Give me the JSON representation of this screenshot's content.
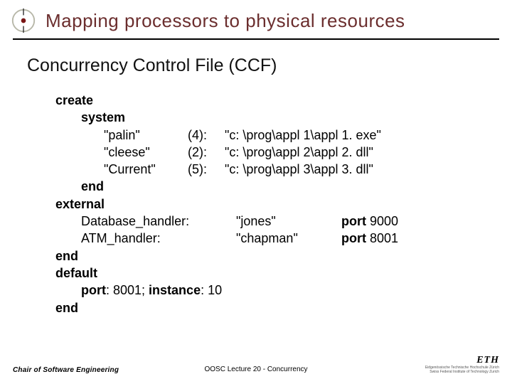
{
  "title": "Mapping processors to physical resources",
  "subtitle": "Concurrency Control File (CCF)",
  "kw": {
    "create": "create",
    "system": "system",
    "end": "end",
    "external": "external",
    "default": "default",
    "port": "port",
    "instance": "instance"
  },
  "system": [
    {
      "name": "\"palin\"",
      "num": "(4):",
      "path": "\"c: \\prog\\appl 1\\appl 1. exe\""
    },
    {
      "name": "\"cleese\"",
      "num": "(2):",
      "path": "\"c: \\prog\\appl 2\\appl 2. dll\""
    },
    {
      "name": "\"Current\"",
      "num": "(5):",
      "path": "\"c: \\prog\\appl 3\\appl 3. dll\""
    }
  ],
  "external": [
    {
      "name": "Database_handler:",
      "host": "\"jones\"",
      "port_val": " 9000"
    },
    {
      "name": "ATM_handler:",
      "host": "\"chapman\"",
      "port_val": " 8001"
    }
  ],
  "defaults": {
    "port_val": ": 8001; ",
    "instance_val": ": 10"
  },
  "footer": {
    "left": "Chair of Software Engineering",
    "center": "OOSC  Lecture 20 - Concurrency",
    "eth": "ETH",
    "eth_sub1": "Eidgenössische Technische Hochschule Zürich",
    "eth_sub2": "Swiss Federal Institute of Technology Zurich"
  }
}
